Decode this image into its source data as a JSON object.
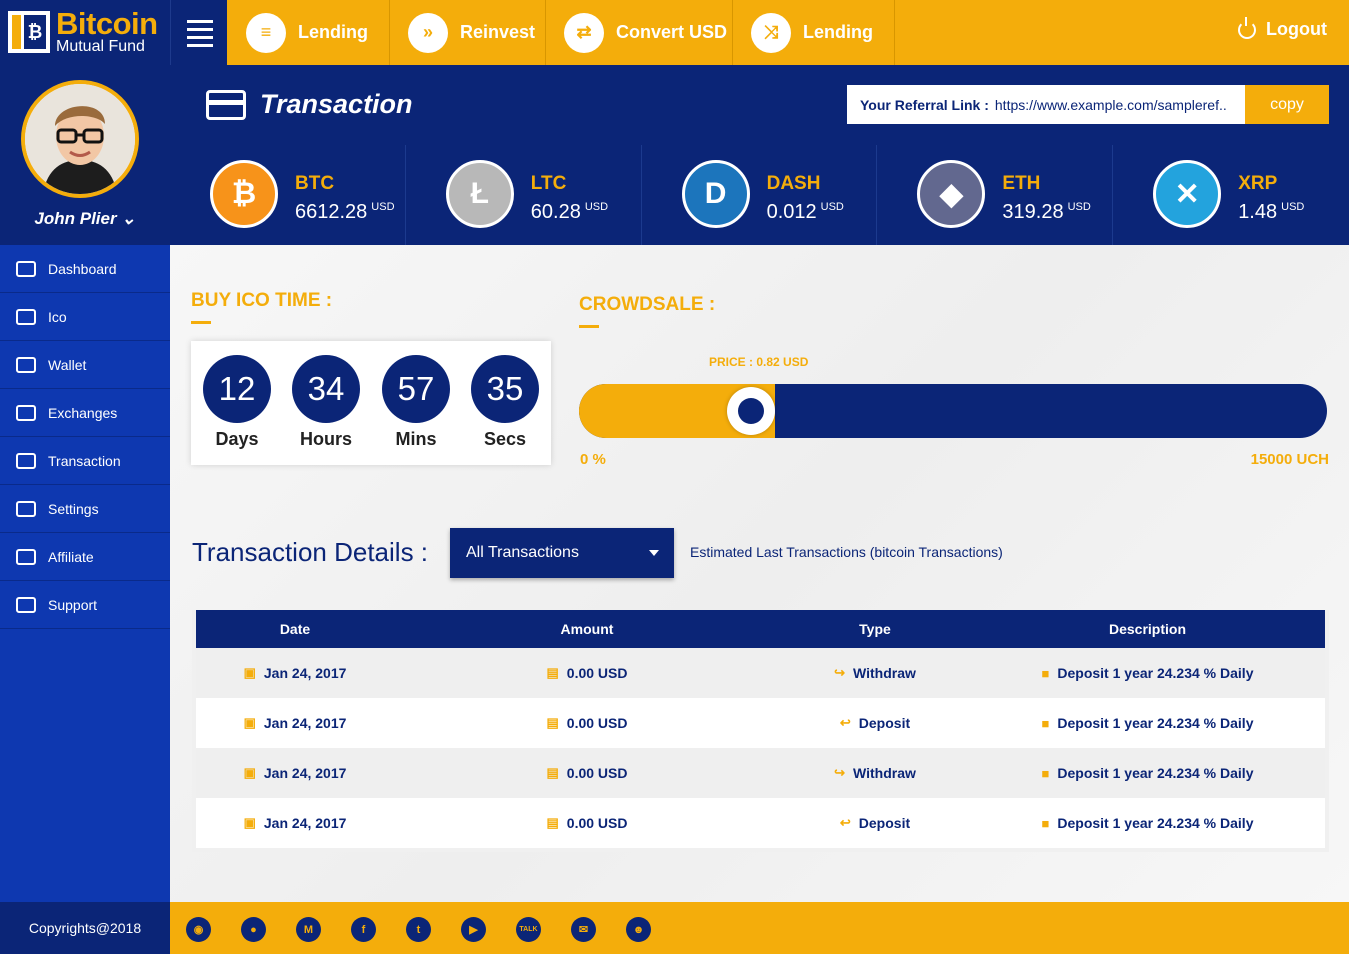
{
  "brand": {
    "title": "Bitcoin",
    "subtitle": "Mutual Fund",
    "mark": "₿"
  },
  "nav": [
    {
      "label": "Lending",
      "icon": "receipt-icon",
      "glyph": "≡"
    },
    {
      "label": "Reinvest",
      "icon": "fast-forward-icon",
      "glyph": "»"
    },
    {
      "label": "Convert USD",
      "icon": "convert-icon",
      "glyph": "⇄"
    },
    {
      "label": "Lending",
      "icon": "shuffle-icon",
      "glyph": "⤨"
    }
  ],
  "logout": "Logout",
  "user": {
    "name": "John Plier",
    "chevron": "⌄"
  },
  "sidebar": [
    {
      "label": "Dashboard",
      "icon": "dashboard-icon"
    },
    {
      "label": "Ico",
      "icon": "crown-icon"
    },
    {
      "label": "Wallet",
      "icon": "wallet-icon"
    },
    {
      "label": "Exchanges",
      "icon": "exchange-icon"
    },
    {
      "label": "Transaction",
      "icon": "transaction-icon"
    },
    {
      "label": "Settings",
      "icon": "settings-icon"
    },
    {
      "label": "Affiliate",
      "icon": "user-icon"
    },
    {
      "label": "Support",
      "icon": "headset-icon"
    }
  ],
  "copyright": "Copyrights@2018",
  "page_title": "Transaction",
  "referral": {
    "label": "Your Referral Link :",
    "url": "https://www.example.com/sampleref..",
    "button": "copy"
  },
  "coins": [
    {
      "symbol": "BTC",
      "value": "6612.28",
      "unit": "USD",
      "glyph": "₿",
      "color": "#f7931a"
    },
    {
      "symbol": "LTC",
      "value": "60.28",
      "unit": "USD",
      "glyph": "Ł",
      "color": "#b8b8b8"
    },
    {
      "symbol": "DASH",
      "value": "0.012",
      "unit": "USD",
      "glyph": "D",
      "color": "#1c75bc"
    },
    {
      "symbol": "ETH",
      "value": "319.28",
      "unit": "USD",
      "glyph": "◆",
      "color": "#62688f"
    },
    {
      "symbol": "XRP",
      "value": "1.48",
      "unit": "USD",
      "glyph": "✕",
      "color": "#23a3dd"
    }
  ],
  "ico": {
    "title": "BUY ICO TIME :",
    "timer": [
      {
        "value": "12",
        "label": "Days"
      },
      {
        "value": "34",
        "label": "Hours"
      },
      {
        "value": "57",
        "label": "Mins"
      },
      {
        "value": "35",
        "label": "Secs"
      }
    ]
  },
  "crowdsale": {
    "title": "CROWDSALE :",
    "price": "PRICE : 0.82 USD",
    "min_label": "0 %",
    "max_label": "15000 UCH",
    "progress": 0.24
  },
  "transactions": {
    "title": "Transaction Details :",
    "filter": "All Transactions",
    "note": "Estimated Last Transactions  (bitcoin Transactions)",
    "headers": [
      "Date",
      "Amount",
      "Type",
      "Description"
    ],
    "rows": [
      {
        "date": "Jan 24, 2017",
        "amount": "0.00 USD",
        "type": "Withdraw",
        "type_glyph": "↪",
        "desc": "Deposit 1 year 24.234 % Daily"
      },
      {
        "date": "Jan 24, 2017",
        "amount": "0.00 USD",
        "type": "Deposit",
        "type_glyph": "↩",
        "desc": "Deposit 1 year 24.234 % Daily"
      },
      {
        "date": "Jan 24, 2017",
        "amount": "0.00 USD",
        "type": "Withdraw",
        "type_glyph": "↪",
        "desc": "Deposit 1 year 24.234 % Daily"
      },
      {
        "date": "Jan 24, 2017",
        "amount": "0.00 USD",
        "type": "Deposit",
        "type_glyph": "↩",
        "desc": "Deposit 1 year 24.234 % Daily"
      }
    ]
  },
  "social": [
    {
      "icon": "github-icon",
      "glyph": "◉"
    },
    {
      "icon": "reddit-icon",
      "glyph": "●"
    },
    {
      "icon": "mendeley-icon",
      "glyph": "M"
    },
    {
      "icon": "facebook-icon",
      "glyph": "f"
    },
    {
      "icon": "twitter-icon",
      "glyph": "t"
    },
    {
      "icon": "youtube-icon",
      "glyph": "▶"
    },
    {
      "icon": "kakaotalk-icon",
      "glyph": "TALK"
    },
    {
      "icon": "mail-icon",
      "glyph": "✉"
    },
    {
      "icon": "discord-icon",
      "glyph": "☻"
    }
  ],
  "colors": {
    "navy": "#0b2577",
    "gold": "#f4ad0b",
    "sidebar": "#0e38b0"
  }
}
